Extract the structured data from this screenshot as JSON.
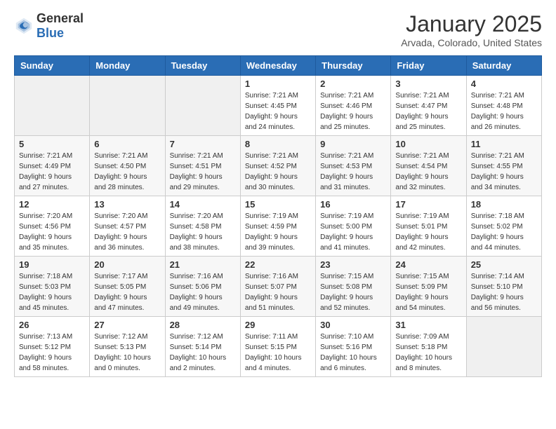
{
  "header": {
    "logo_general": "General",
    "logo_blue": "Blue",
    "month": "January 2025",
    "location": "Arvada, Colorado, United States"
  },
  "weekdays": [
    "Sunday",
    "Monday",
    "Tuesday",
    "Wednesday",
    "Thursday",
    "Friday",
    "Saturday"
  ],
  "weeks": [
    [
      {
        "day": "",
        "sunrise": "",
        "sunset": "",
        "daylight": ""
      },
      {
        "day": "",
        "sunrise": "",
        "sunset": "",
        "daylight": ""
      },
      {
        "day": "",
        "sunrise": "",
        "sunset": "",
        "daylight": ""
      },
      {
        "day": "1",
        "sunrise": "Sunrise: 7:21 AM",
        "sunset": "Sunset: 4:45 PM",
        "daylight": "Daylight: 9 hours and 24 minutes."
      },
      {
        "day": "2",
        "sunrise": "Sunrise: 7:21 AM",
        "sunset": "Sunset: 4:46 PM",
        "daylight": "Daylight: 9 hours and 25 minutes."
      },
      {
        "day": "3",
        "sunrise": "Sunrise: 7:21 AM",
        "sunset": "Sunset: 4:47 PM",
        "daylight": "Daylight: 9 hours and 25 minutes."
      },
      {
        "day": "4",
        "sunrise": "Sunrise: 7:21 AM",
        "sunset": "Sunset: 4:48 PM",
        "daylight": "Daylight: 9 hours and 26 minutes."
      }
    ],
    [
      {
        "day": "5",
        "sunrise": "Sunrise: 7:21 AM",
        "sunset": "Sunset: 4:49 PM",
        "daylight": "Daylight: 9 hours and 27 minutes."
      },
      {
        "day": "6",
        "sunrise": "Sunrise: 7:21 AM",
        "sunset": "Sunset: 4:50 PM",
        "daylight": "Daylight: 9 hours and 28 minutes."
      },
      {
        "day": "7",
        "sunrise": "Sunrise: 7:21 AM",
        "sunset": "Sunset: 4:51 PM",
        "daylight": "Daylight: 9 hours and 29 minutes."
      },
      {
        "day": "8",
        "sunrise": "Sunrise: 7:21 AM",
        "sunset": "Sunset: 4:52 PM",
        "daylight": "Daylight: 9 hours and 30 minutes."
      },
      {
        "day": "9",
        "sunrise": "Sunrise: 7:21 AM",
        "sunset": "Sunset: 4:53 PM",
        "daylight": "Daylight: 9 hours and 31 minutes."
      },
      {
        "day": "10",
        "sunrise": "Sunrise: 7:21 AM",
        "sunset": "Sunset: 4:54 PM",
        "daylight": "Daylight: 9 hours and 32 minutes."
      },
      {
        "day": "11",
        "sunrise": "Sunrise: 7:21 AM",
        "sunset": "Sunset: 4:55 PM",
        "daylight": "Daylight: 9 hours and 34 minutes."
      }
    ],
    [
      {
        "day": "12",
        "sunrise": "Sunrise: 7:20 AM",
        "sunset": "Sunset: 4:56 PM",
        "daylight": "Daylight: 9 hours and 35 minutes."
      },
      {
        "day": "13",
        "sunrise": "Sunrise: 7:20 AM",
        "sunset": "Sunset: 4:57 PM",
        "daylight": "Daylight: 9 hours and 36 minutes."
      },
      {
        "day": "14",
        "sunrise": "Sunrise: 7:20 AM",
        "sunset": "Sunset: 4:58 PM",
        "daylight": "Daylight: 9 hours and 38 minutes."
      },
      {
        "day": "15",
        "sunrise": "Sunrise: 7:19 AM",
        "sunset": "Sunset: 4:59 PM",
        "daylight": "Daylight: 9 hours and 39 minutes."
      },
      {
        "day": "16",
        "sunrise": "Sunrise: 7:19 AM",
        "sunset": "Sunset: 5:00 PM",
        "daylight": "Daylight: 9 hours and 41 minutes."
      },
      {
        "day": "17",
        "sunrise": "Sunrise: 7:19 AM",
        "sunset": "Sunset: 5:01 PM",
        "daylight": "Daylight: 9 hours and 42 minutes."
      },
      {
        "day": "18",
        "sunrise": "Sunrise: 7:18 AM",
        "sunset": "Sunset: 5:02 PM",
        "daylight": "Daylight: 9 hours and 44 minutes."
      }
    ],
    [
      {
        "day": "19",
        "sunrise": "Sunrise: 7:18 AM",
        "sunset": "Sunset: 5:03 PM",
        "daylight": "Daylight: 9 hours and 45 minutes."
      },
      {
        "day": "20",
        "sunrise": "Sunrise: 7:17 AM",
        "sunset": "Sunset: 5:05 PM",
        "daylight": "Daylight: 9 hours and 47 minutes."
      },
      {
        "day": "21",
        "sunrise": "Sunrise: 7:16 AM",
        "sunset": "Sunset: 5:06 PM",
        "daylight": "Daylight: 9 hours and 49 minutes."
      },
      {
        "day": "22",
        "sunrise": "Sunrise: 7:16 AM",
        "sunset": "Sunset: 5:07 PM",
        "daylight": "Daylight: 9 hours and 51 minutes."
      },
      {
        "day": "23",
        "sunrise": "Sunrise: 7:15 AM",
        "sunset": "Sunset: 5:08 PM",
        "daylight": "Daylight: 9 hours and 52 minutes."
      },
      {
        "day": "24",
        "sunrise": "Sunrise: 7:15 AM",
        "sunset": "Sunset: 5:09 PM",
        "daylight": "Daylight: 9 hours and 54 minutes."
      },
      {
        "day": "25",
        "sunrise": "Sunrise: 7:14 AM",
        "sunset": "Sunset: 5:10 PM",
        "daylight": "Daylight: 9 hours and 56 minutes."
      }
    ],
    [
      {
        "day": "26",
        "sunrise": "Sunrise: 7:13 AM",
        "sunset": "Sunset: 5:12 PM",
        "daylight": "Daylight: 9 hours and 58 minutes."
      },
      {
        "day": "27",
        "sunrise": "Sunrise: 7:12 AM",
        "sunset": "Sunset: 5:13 PM",
        "daylight": "Daylight: 10 hours and 0 minutes."
      },
      {
        "day": "28",
        "sunrise": "Sunrise: 7:12 AM",
        "sunset": "Sunset: 5:14 PM",
        "daylight": "Daylight: 10 hours and 2 minutes."
      },
      {
        "day": "29",
        "sunrise": "Sunrise: 7:11 AM",
        "sunset": "Sunset: 5:15 PM",
        "daylight": "Daylight: 10 hours and 4 minutes."
      },
      {
        "day": "30",
        "sunrise": "Sunrise: 7:10 AM",
        "sunset": "Sunset: 5:16 PM",
        "daylight": "Daylight: 10 hours and 6 minutes."
      },
      {
        "day": "31",
        "sunrise": "Sunrise: 7:09 AM",
        "sunset": "Sunset: 5:18 PM",
        "daylight": "Daylight: 10 hours and 8 minutes."
      },
      {
        "day": "",
        "sunrise": "",
        "sunset": "",
        "daylight": ""
      }
    ]
  ]
}
